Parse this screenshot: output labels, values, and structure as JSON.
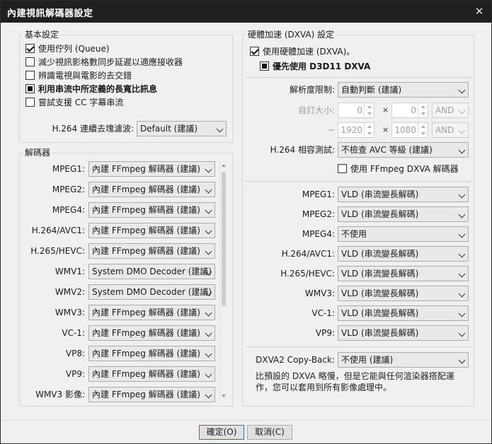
{
  "window": {
    "title": "內建視訊解碼器設定",
    "close_glyph": "✕"
  },
  "basic": {
    "title": "基本設定",
    "options": [
      {
        "label": "使用佇列 (Queue)",
        "state": "checked"
      },
      {
        "label": "減少視訊影格數同步延遲以適應接收器",
        "state": "unchecked"
      },
      {
        "label": "辨識電視與電影的去交錯",
        "state": "unchecked"
      },
      {
        "label": "利用串流中所定義的長寬比訊息",
        "state": "indeterminate"
      },
      {
        "label": "嘗試支援 CC 字幕串流",
        "state": "unchecked"
      }
    ],
    "deblock_label": "H.264 連續去塊濾波:",
    "deblock_value": "Default (建議)"
  },
  "decoders": {
    "title": "解碼器",
    "rows": [
      {
        "label": "MPEG1:",
        "value": "內建 FFmpeg 解碼器 (建議)"
      },
      {
        "label": "MPEG2:",
        "value": "內建 FFmpeg 解碼器 (建議)"
      },
      {
        "label": "MPEG4:",
        "value": "內建 FFmpeg 解碼器 (建議)"
      },
      {
        "label": "H.264/AVC1:",
        "value": "內建 FFmpeg 解碼器 (建議)"
      },
      {
        "label": "H.265/HEVC:",
        "value": "內建 FFmpeg 解碼器 (建議)"
      },
      {
        "label": "WMV1:",
        "value": "System DMO Decoder (建議)"
      },
      {
        "label": "WMV2:",
        "value": "System DMO Decoder (建議)"
      },
      {
        "label": "WMV3:",
        "value": "內建 FFmpeg 解碼器 (建議)"
      },
      {
        "label": "VC-1:",
        "value": "內建 FFmpeg 解碼器 (建議)"
      },
      {
        "label": "VP8:",
        "value": "內建 FFmpeg 解碼器 (建議)"
      },
      {
        "label": "VP9:",
        "value": "內建 FFmpeg 解碼器 (建議)"
      },
      {
        "label": "WMV3 影像:",
        "value": "內建 FFmpeg 解碼器 (建議)"
      }
    ]
  },
  "hw": {
    "title": "硬體加速 (DXVA) 設定",
    "use_hw_label": "使用硬體加速 (DXVA)。",
    "prefer_d3d11_label": "優先使用 D3D11 DXVA",
    "res_limit_label": "解析度限制:",
    "res_limit_value": "自動判斷 (建議)",
    "custom_size_label": "自訂大小:",
    "min_w": "0",
    "min_h": "0",
    "max_w": "1920",
    "max_h": "1080",
    "range_tilde": "~",
    "times": "×",
    "and_value": "AND",
    "compat_label": "H.264 相容測試:",
    "compat_value": "不檢查 AVC 等級 (建議)",
    "ffmpeg_dxva_label": "使用 FFmpeg DXVA 解碼器",
    "rows": [
      {
        "label": "MPEG1:",
        "value": "VLD (串流變長解碼)"
      },
      {
        "label": "MPEG2:",
        "value": "VLD (串流變長解碼)"
      },
      {
        "label": "MPEG4:",
        "value": "不使用"
      },
      {
        "label": "H.264/AVC1:",
        "value": "VLD (串流變長解碼)"
      },
      {
        "label": "H.265/HEVC:",
        "value": "VLD (串流變長解碼)"
      },
      {
        "label": "WMV3:",
        "value": "VLD (串流變長解碼)"
      },
      {
        "label": "VC-1:",
        "value": "VLD (串流變長解碼)"
      },
      {
        "label": "VP9:",
        "value": "VLD (串流變長解碼)"
      }
    ],
    "copyback_label": "DXVA2 Copy-Back:",
    "copyback_value": "不使用 (建議)",
    "note_line1": "比預設的 DXVA 略慢，但是它能與任何渲染器搭配運",
    "note_line2": "作，您可以套用到所有影像處理中。"
  },
  "buttons": {
    "ok": "確定(O)",
    "cancel": "取消(C)"
  }
}
